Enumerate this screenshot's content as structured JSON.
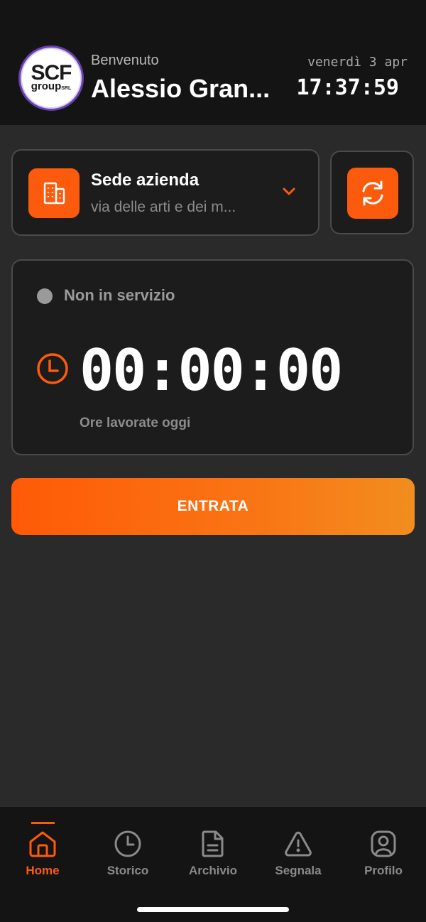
{
  "header": {
    "logo_text": "SCF",
    "logo_sub": "group",
    "logo_sub_small": "SRL",
    "welcome": "Benvenuto",
    "username": "Alessio Gran...",
    "date": "venerdì 3 apr",
    "time": "17:37:59"
  },
  "location": {
    "title": "Sede azienda",
    "address": "via delle arti e dei m..."
  },
  "status": {
    "label": "Non in servizio",
    "timer": "00:00:00",
    "hours_label": "Ore lavorate oggi"
  },
  "actions": {
    "entry_label": "ENTRATA"
  },
  "nav": {
    "items": [
      {
        "label": "Home",
        "icon": "home-icon",
        "active": true
      },
      {
        "label": "Storico",
        "icon": "clock-icon",
        "active": false
      },
      {
        "label": "Archivio",
        "icon": "document-icon",
        "active": false
      },
      {
        "label": "Segnala",
        "icon": "warning-icon",
        "active": false
      },
      {
        "label": "Profilo",
        "icon": "profile-icon",
        "active": false
      }
    ]
  },
  "colors": {
    "accent": "#fc5a0c",
    "background": "#2a2a2a",
    "surface": "#1c1c1c",
    "header": "#141414",
    "muted": "#8c8c8c"
  }
}
